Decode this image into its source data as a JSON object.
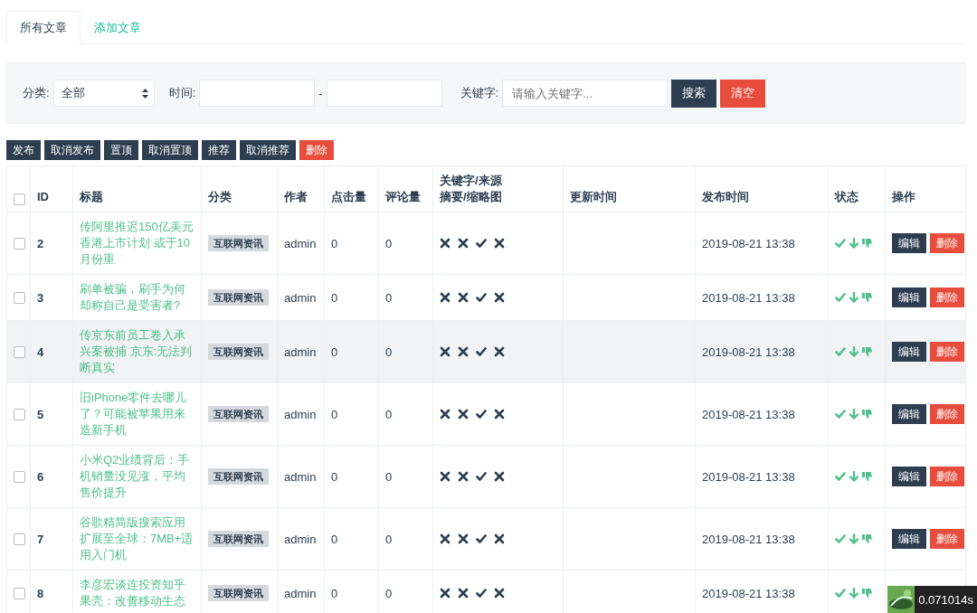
{
  "tabs": [
    {
      "label": "所有文章",
      "selected": true
    },
    {
      "label": "添加文章",
      "selected": false
    }
  ],
  "filter": {
    "category_label": "分类:",
    "category_value": "全部",
    "time_label": "时间:",
    "time_separator": "-",
    "keyword_label": "关键字:",
    "keyword_placeholder": "请输入关键字...",
    "search_button": "搜索",
    "clear_button": "清空"
  },
  "actions": [
    {
      "label": "发布",
      "kind": "normal"
    },
    {
      "label": "取消发布",
      "kind": "normal"
    },
    {
      "label": "置顶",
      "kind": "normal"
    },
    {
      "label": "取消置顶",
      "kind": "normal"
    },
    {
      "label": "推荐",
      "kind": "normal"
    },
    {
      "label": "取消推荐",
      "kind": "normal"
    },
    {
      "label": "删除",
      "kind": "danger"
    }
  ],
  "table": {
    "select_all_checked": false,
    "columns": [
      [
        "ID"
      ],
      [
        "标题"
      ],
      [
        "分类"
      ],
      [
        "作者"
      ],
      [
        "点击量"
      ],
      [
        "评论量"
      ],
      [
        "关键字/来源",
        "摘要/缩略图"
      ],
      [
        "更新时间"
      ],
      [
        "发布时间"
      ],
      [
        "状态"
      ],
      [
        "操作"
      ]
    ],
    "rows": [
      {
        "checked": false,
        "id": "2",
        "title": "传阿里推迟150亿美元香港上市计划 或于10月份重",
        "category": "互联网资讯",
        "author": "admin",
        "clicks": "0",
        "comments": "0",
        "flags": [
          false,
          false,
          true,
          false
        ],
        "published": "2019-08-21 13:38",
        "hovered": false,
        "edit": "编辑",
        "delete": "删除"
      },
      {
        "checked": false,
        "id": "3",
        "title": "刷单被骗，刷手为何却称自己是受害者?",
        "category": "互联网资讯",
        "author": "admin",
        "clicks": "0",
        "comments": "0",
        "flags": [
          false,
          false,
          true,
          false
        ],
        "published": "2019-08-21 13:38",
        "hovered": false,
        "edit": "编辑",
        "delete": "删除"
      },
      {
        "checked": false,
        "id": "4",
        "title": "传京东前员工卷入承兴案被捕 京东:无法判断真实",
        "category": "互联网资讯",
        "author": "admin",
        "clicks": "0",
        "comments": "0",
        "flags": [
          false,
          false,
          true,
          false
        ],
        "published": "2019-08-21 13:38",
        "hovered": true,
        "edit": "编辑",
        "delete": "删除"
      },
      {
        "checked": false,
        "id": "5",
        "title": "旧iPhone零件去哪儿了？可能被苹果用来造新手机",
        "category": "互联网资讯",
        "author": "admin",
        "clicks": "0",
        "comments": "0",
        "flags": [
          false,
          false,
          true,
          false
        ],
        "published": "2019-08-21 13:38",
        "hovered": false,
        "edit": "编辑",
        "delete": "删除"
      },
      {
        "checked": false,
        "id": "6",
        "title": "小米Q2业绩背后：手机销量没见涨，平均售价提升",
        "category": "互联网资讯",
        "author": "admin",
        "clicks": "0",
        "comments": "0",
        "flags": [
          false,
          false,
          true,
          false
        ],
        "published": "2019-08-21 13:38",
        "hovered": false,
        "edit": "编辑",
        "delete": "删除"
      },
      {
        "checked": false,
        "id": "7",
        "title": "谷歌精简版搜索应用扩展至全球：7MB+适用入门机",
        "category": "互联网资讯",
        "author": "admin",
        "clicks": "0",
        "comments": "0",
        "flags": [
          false,
          false,
          true,
          false
        ],
        "published": "2019-08-21 13:38",
        "hovered": false,
        "edit": "编辑",
        "delete": "删除"
      },
      {
        "checked": false,
        "id": "8",
        "title": "李彦宏谈连投资知乎果壳：改善移动生态",
        "category": "互联网资讯",
        "author": "admin",
        "clicks": "0",
        "comments": "0",
        "flags": [
          false,
          false,
          true,
          false
        ],
        "published": "2019-08-21 13:38",
        "hovered": false
      }
    ]
  },
  "trace": {
    "runtime": "0.071014s"
  }
}
